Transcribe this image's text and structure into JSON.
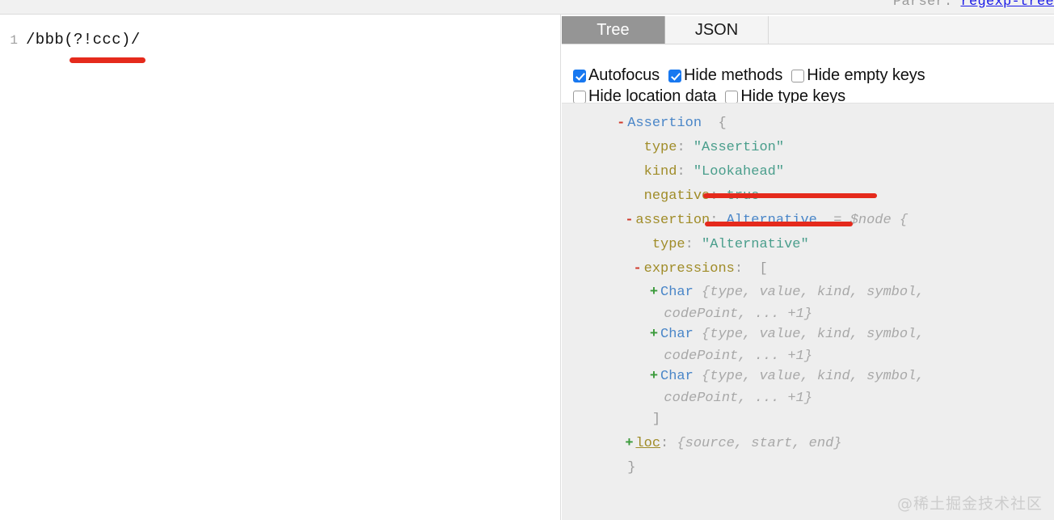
{
  "header": {
    "parser_label": "Parser:",
    "parser_link": "regexp-tree"
  },
  "editor": {
    "line_number": "1",
    "code": "/bbb(?!ccc)/"
  },
  "panel": {
    "tabs": [
      {
        "label": "Tree",
        "active": true
      },
      {
        "label": "JSON",
        "active": false
      }
    ],
    "options": [
      {
        "label": "Autofocus",
        "checked": true
      },
      {
        "label": "Hide methods",
        "checked": true
      },
      {
        "label": "Hide empty keys",
        "checked": false
      },
      {
        "label": "Hide location data",
        "checked": false
      },
      {
        "label": "Hide type keys",
        "checked": false
      }
    ]
  },
  "tree": {
    "lines": [
      {
        "toggle": "-",
        "indent": 6,
        "text": "Assertion  {",
        "segments": [
          {
            "t": "Assertion",
            "c": "k-node"
          },
          {
            "t": "  {",
            "c": "k-punct"
          }
        ]
      },
      {
        "toggle": "",
        "indent": 8,
        "segments": [
          {
            "t": "type",
            "c": "k-key"
          },
          {
            "t": ": ",
            "c": "k-punct"
          },
          {
            "t": "\"Assertion\"",
            "c": "k-str"
          }
        ]
      },
      {
        "toggle": "",
        "indent": 8,
        "segments": [
          {
            "t": "kind",
            "c": "k-key"
          },
          {
            "t": ": ",
            "c": "k-punct"
          },
          {
            "t": "\"Lookahead\"",
            "c": "k-str"
          }
        ]
      },
      {
        "toggle": "",
        "indent": 8,
        "segments": [
          {
            "t": "negative",
            "c": "k-key"
          },
          {
            "t": ": ",
            "c": "k-punct"
          },
          {
            "t": "true",
            "c": "k-bool"
          }
        ]
      },
      {
        "toggle": "-",
        "indent": 7,
        "segments": [
          {
            "t": "assertion",
            "c": "k-key"
          },
          {
            "t": ": ",
            "c": "k-punct"
          },
          {
            "t": "Alternative",
            "c": "k-node"
          },
          {
            "t": "  = $node {",
            "c": "k-dim"
          }
        ]
      },
      {
        "toggle": "",
        "indent": 9,
        "segments": [
          {
            "t": "type",
            "c": "k-key"
          },
          {
            "t": ": ",
            "c": "k-punct"
          },
          {
            "t": "\"Alternative\"",
            "c": "k-str"
          }
        ]
      },
      {
        "toggle": "-",
        "indent": 8,
        "segments": [
          {
            "t": "expressions",
            "c": "k-key"
          },
          {
            "t": ":  [",
            "c": "k-punct"
          }
        ]
      },
      {
        "toggle": "+",
        "indent": 10,
        "wrap": true,
        "segments": [
          {
            "t": "Char",
            "c": "k-node"
          },
          {
            "t": " {type, value, kind, symbol,",
            "c": "k-dim"
          },
          {
            "t": "\n            codePoint, ... +1}",
            "c": "k-dim"
          }
        ]
      },
      {
        "toggle": "+",
        "indent": 10,
        "wrap": true,
        "segments": [
          {
            "t": "Char",
            "c": "k-node"
          },
          {
            "t": " {type, value, kind, symbol,",
            "c": "k-dim"
          },
          {
            "t": "\n            codePoint, ... +1}",
            "c": "k-dim"
          }
        ]
      },
      {
        "toggle": "+",
        "indent": 10,
        "wrap": true,
        "segments": [
          {
            "t": "Char",
            "c": "k-node"
          },
          {
            "t": " {type, value, kind, symbol,",
            "c": "k-dim"
          },
          {
            "t": "\n            codePoint, ... +1}",
            "c": "k-dim"
          }
        ]
      },
      {
        "toggle": "",
        "indent": 9,
        "segments": [
          {
            "t": "]",
            "c": "k-punct"
          }
        ]
      },
      {
        "toggle": "+",
        "indent": 7,
        "segments": [
          {
            "t": "loc",
            "c": "k-key-u"
          },
          {
            "t": ": ",
            "c": "k-punct"
          },
          {
            "t": "{source, start, end}",
            "c": "k-dim"
          }
        ]
      },
      {
        "toggle": "",
        "indent": 6,
        "segments": [
          {
            "t": "}",
            "c": "k-punct"
          }
        ]
      }
    ]
  },
  "watermark": "@稀土掘金技术社区",
  "colors": {
    "underline_red": "#e52a1c",
    "checkbox_blue": "#1878f0",
    "active_tab_bg": "#959595",
    "tree_bg": "#eeeeee",
    "node_blue": "#4a86c8",
    "key_olive": "#a08c28",
    "string_teal": "#4a9e8c",
    "link_blue": "#1a1ae8"
  }
}
